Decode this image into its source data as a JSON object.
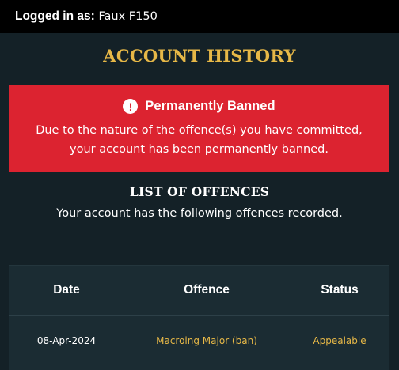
{
  "header": {
    "logged_in_label": "Logged in as:",
    "username": "Faux F150"
  },
  "page": {
    "title": "ACCOUNT HISTORY"
  },
  "alert": {
    "icon": "exclamation-circle-icon",
    "title": "Permanently Banned",
    "line1": "Due to the nature of the offence(s) you have committed,",
    "line2": "your account has been permanently banned.",
    "color": "#dc2330"
  },
  "offences": {
    "heading": "LIST OF OFFENCES",
    "description": "Your account has the following offences recorded.",
    "columns": [
      "Date",
      "Offence",
      "Status"
    ],
    "rows": [
      {
        "date": "08-Apr-2024",
        "offence": "Macroing Major (ban)",
        "status": "Appealable"
      }
    ]
  },
  "colors": {
    "accent_gold": "#e7b847",
    "background": "#142127",
    "table_bg": "#1b2c33"
  }
}
